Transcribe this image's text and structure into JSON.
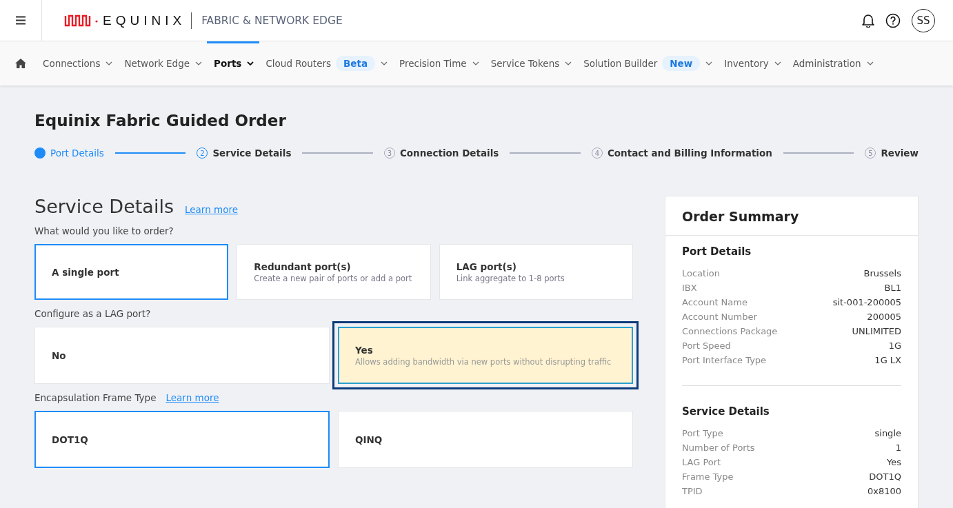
{
  "header": {
    "logo_text": "EQUINIX",
    "product": "FABRIC & NETWORK EDGE",
    "avatar": "SS"
  },
  "nav": [
    {
      "label": "Connections",
      "selected": false
    },
    {
      "label": "Network Edge",
      "selected": false
    },
    {
      "label": "Ports",
      "selected": true
    },
    {
      "label": "Cloud Routers",
      "badge": "Beta",
      "selected": false
    },
    {
      "label": "Precision Time",
      "selected": false
    },
    {
      "label": "Service Tokens",
      "selected": false
    },
    {
      "label": "Solution Builder",
      "badge": "New",
      "selected": false
    },
    {
      "label": "Inventory",
      "selected": false
    },
    {
      "label": "Administration",
      "selected": false
    }
  ],
  "page_title": "Equinix Fabric Guided Order",
  "steps": [
    {
      "label": "Port Details",
      "kind": "done"
    },
    {
      "number": "2",
      "label": "Service Details",
      "kind": "current"
    },
    {
      "number": "3",
      "label": "Connection Details",
      "kind": "upcoming"
    },
    {
      "number": "4",
      "label": "Contact and Billing Information",
      "kind": "upcoming"
    },
    {
      "number": "5",
      "label": "Review",
      "kind": "upcoming"
    }
  ],
  "section": {
    "title": "Service Details",
    "link": "Learn more"
  },
  "groups": [
    {
      "question": "What would you like to order?",
      "options": [
        {
          "title": "A single port",
          "selected": true
        },
        {
          "title": "Redundant port(s)",
          "description": "Create a new pair of ports or add a port",
          "selected": false
        },
        {
          "title": "LAG port(s)",
          "description": "Link aggregate to 1-8 ports",
          "selected": false
        }
      ]
    },
    {
      "question": "Configure as a LAG port?",
      "options": [
        {
          "title": "No",
          "selected": false
        },
        {
          "title": "Yes",
          "description": "Allows adding bandwidth via new ports without disrupting traffic",
          "selected": true
        }
      ]
    },
    {
      "question": "Encapsulation Frame Type",
      "link": "Learn more",
      "options": [
        {
          "title": "DOT1Q",
          "selected": true
        },
        {
          "title": "QINQ",
          "selected": false
        }
      ]
    }
  ],
  "summary": {
    "title": "Order Summary",
    "sections": [
      {
        "title": "Port Details",
        "rows": [
          {
            "label": "Location",
            "value": "Brussels"
          },
          {
            "label": "IBX",
            "value": "BL1"
          },
          {
            "label": "Account Name",
            "value": "sit-001-200005"
          },
          {
            "label": "Account Number",
            "value": "200005"
          },
          {
            "label": "Connections Package",
            "value": "UNLIMITED"
          },
          {
            "label": "Port Speed",
            "value": "1G"
          },
          {
            "label": "Port Interface Type",
            "value": "1G LX"
          }
        ]
      },
      {
        "title": "Service Details",
        "rows": [
          {
            "label": "Port Type",
            "value": "single"
          },
          {
            "label": "Number of Ports",
            "value": "1"
          },
          {
            "label": "LAG Port",
            "value": "Yes"
          },
          {
            "label": "Frame Type",
            "value": "DOT1Q"
          },
          {
            "label": "TPID",
            "value": "0x8100"
          }
        ]
      }
    ]
  }
}
